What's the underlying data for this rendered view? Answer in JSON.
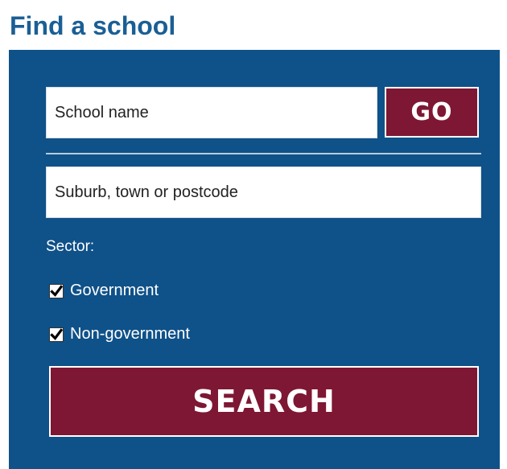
{
  "widget": {
    "title": "Find a school"
  },
  "school_search": {
    "placeholder": "School name",
    "value": "",
    "go_label": "GO"
  },
  "location_search": {
    "placeholder": "Suburb, town or postcode",
    "value": ""
  },
  "sector": {
    "label": "Sector:",
    "options": [
      {
        "label": "Government",
        "checked": true
      },
      {
        "label": "Non-government",
        "checked": true
      }
    ]
  },
  "search_button": {
    "label": "SEARCH"
  },
  "colors": {
    "heading": "#1a5f95",
    "panel": "#0f5189",
    "button": "#7e1733"
  }
}
